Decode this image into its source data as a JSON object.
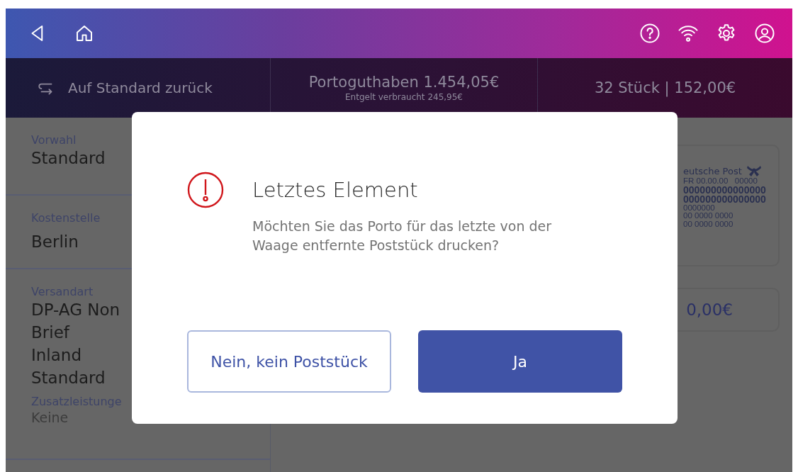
{
  "stats_bar": {
    "reset_button": "Auf Standard zurück",
    "balance": "Portoguthaben 1.454,05€",
    "balance_note": "Entgelt verbraucht 245,95€",
    "count": "32 Stück | 152,00€"
  },
  "settings": [
    {
      "fields": [
        {
          "label": "Vorwahl",
          "values": [
            "Standard"
          ],
          "muted": false
        }
      ]
    },
    {
      "fields": [
        {
          "label": "Kostenstelle",
          "values": [
            "Berlin"
          ],
          "muted": false
        }
      ]
    },
    {
      "fields": [
        {
          "label": "Versandart",
          "values": [
            "DP-AG Non",
            "Brief",
            "Inland",
            "Standard"
          ],
          "muted": false
        },
        {
          "label": "Zusatzleistunge",
          "values": [
            "Keine"
          ],
          "muted": true
        }
      ]
    }
  ],
  "stamp_preview": {
    "brand": "eutsche Post",
    "lines": [
      {
        "text": "FR 00.00.00   00000",
        "bold": false
      },
      {
        "text": "000000000000000",
        "bold": true
      },
      {
        "text": "000000000000000",
        "bold": true
      },
      {
        "text": "0000000",
        "bold": false
      },
      {
        "text": "00 0000 0000",
        "bold": false
      },
      {
        "text": "00 0000 0000",
        "bold": false
      }
    ]
  },
  "amount": "0,00€",
  "dialog": {
    "title": "Letztes Element",
    "message": "Möchten Sie das Porto für das letzte von der Waage entfernte Poststück drucken?",
    "buttons": [
      {
        "label": "Nein, kein Poststück",
        "kind": "secondary"
      },
      {
        "label": "Ja",
        "kind": "primary"
      }
    ]
  }
}
